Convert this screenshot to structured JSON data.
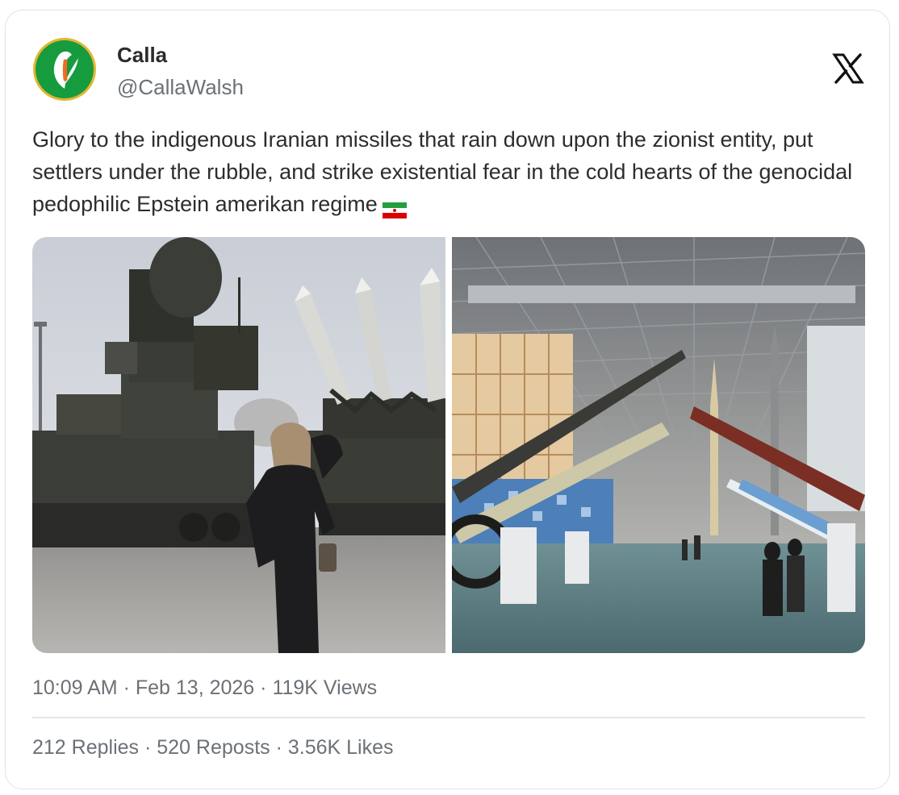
{
  "author": {
    "display_name": "Calla",
    "handle": "@CallaWalsh",
    "avatar_icon": "calla-lily-logo-icon"
  },
  "platform_icon": "x-logo-icon",
  "tweet": {
    "text": "Glory to the indigenous Iranian missiles that rain down upon the zionist entity, put settlers under the rubble, and strike existential fear in the cold hearts of the genocidal pedophilic Epstein amerikan regime",
    "emoji": "iran-flag-icon"
  },
  "media": [
    {
      "name": "photo-woman-with-missile-launcher",
      "kind": "photo"
    },
    {
      "name": "photo-missile-exhibition-hall",
      "kind": "photo"
    }
  ],
  "meta": {
    "time": "10:09 AM",
    "date": "Feb 13, 2026",
    "views": "119K Views"
  },
  "stats": {
    "replies": "212 Replies",
    "reposts": "520 Reposts",
    "likes": "3.56K Likes"
  },
  "colors": {
    "avatar_green": "#169b3f",
    "avatar_ring": "#e2b730",
    "text": "#2d2d2d",
    "muted": "#6b7177",
    "border": "#dfe3e6"
  }
}
